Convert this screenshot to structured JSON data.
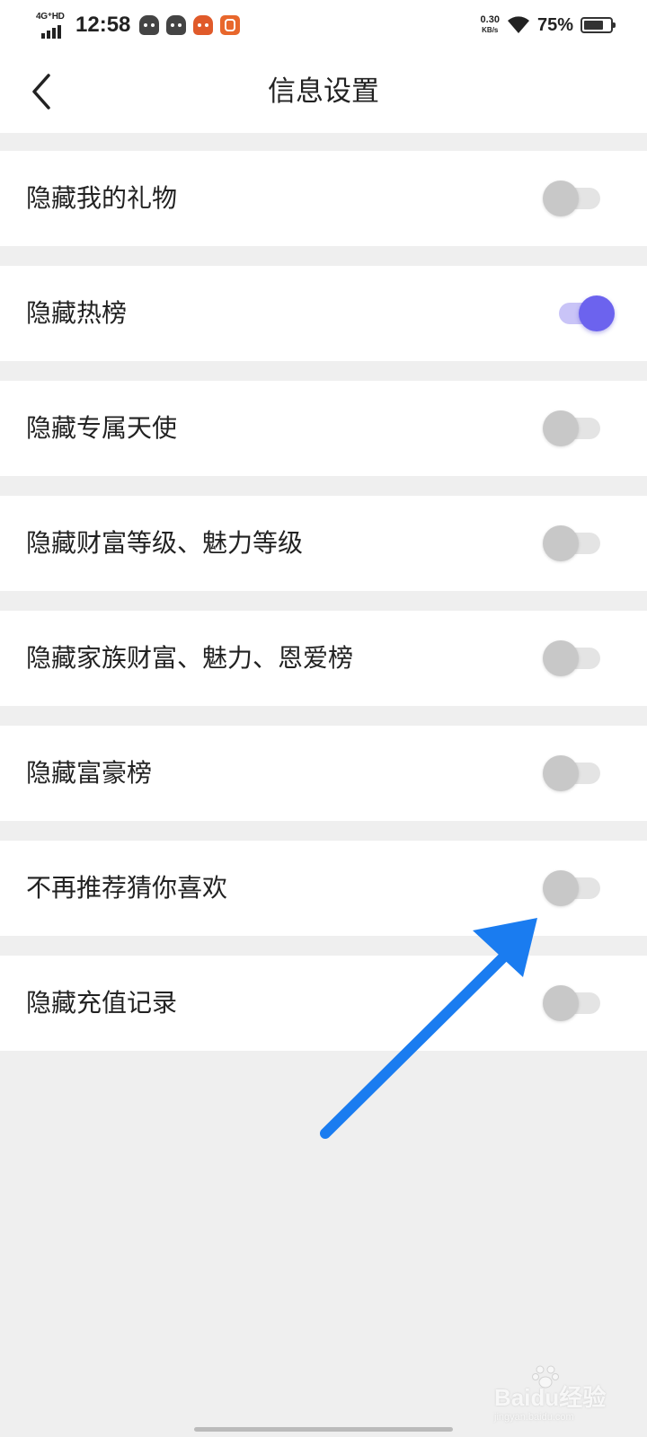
{
  "status_bar": {
    "network": "4G⁺HD",
    "time": "12:58",
    "speed_value": "0.30",
    "speed_unit": "KB/s",
    "battery_percent": "75%",
    "battery_level": 0.75
  },
  "header": {
    "title": "信息设置"
  },
  "settings": [
    {
      "label": "隐藏我的礼物",
      "on": false
    },
    {
      "label": "隐藏热榜",
      "on": true
    },
    {
      "label": "隐藏专属天使",
      "on": false
    },
    {
      "label": "隐藏财富等级、魅力等级",
      "on": false
    },
    {
      "label": "隐藏家族财富、魅力、恩爱榜",
      "on": false
    },
    {
      "label": "隐藏富豪榜",
      "on": false
    },
    {
      "label": "不再推荐猜你喜欢",
      "on": false
    },
    {
      "label": "隐藏充值记录",
      "on": false
    }
  ],
  "watermark": {
    "text": "Baidu经验",
    "sub": "jingyan.baidu.com"
  },
  "colors": {
    "switch_on": "#6c63ee",
    "switch_off": "#c8c8c8",
    "annotation_arrow": "#1a7cf0",
    "background": "#efefef"
  }
}
